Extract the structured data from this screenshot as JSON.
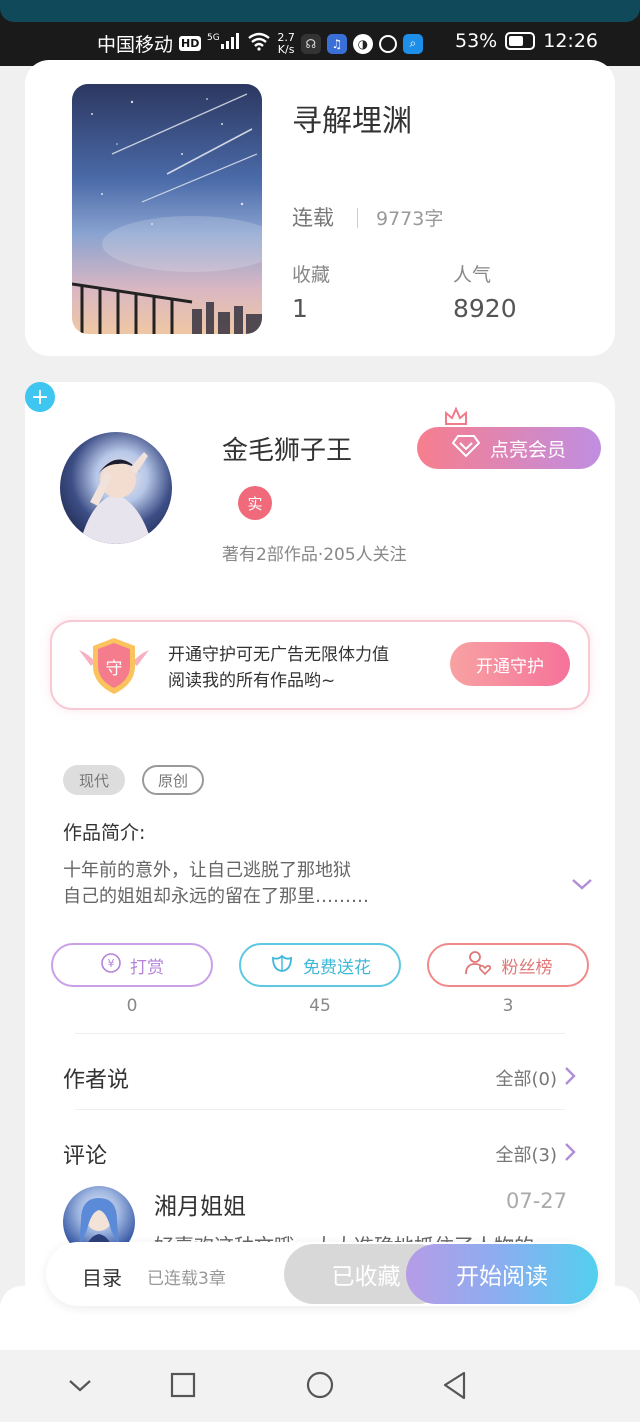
{
  "status_bar": {
    "carrier": "中国移动",
    "hd_badge": "HD",
    "signal_label": "5G",
    "net_speed_value": "2.7",
    "net_speed_unit": "K/s",
    "battery": "53%",
    "time": "12:26"
  },
  "book": {
    "title": "寻解埋渊",
    "status": "连载",
    "word_count": "9773字",
    "favorites_label": "收藏",
    "favorites_value": "1",
    "popularity_label": "人气",
    "popularity_value": "8920"
  },
  "author": {
    "name": "金毛狮子王",
    "verified_badge": "实",
    "stats": "著有2部作品·205人关注",
    "vip_button": "点亮会员"
  },
  "guard_banner": {
    "badge_text": "守",
    "line1": "开通守护可无广告无限体力值",
    "line2": "阅读我的所有作品哟~",
    "button": "开通守护"
  },
  "tags": {
    "items": [
      "现代",
      "原创"
    ],
    "add": "+"
  },
  "intro": {
    "title": "作品简介:",
    "line1": "十年前的意外，让自己逃脱了那地狱",
    "line2": "自己的姐姐却永远的留在了那里………"
  },
  "actions": {
    "reward": {
      "label": "打赏",
      "count": "0",
      "icon": "yen-icon"
    },
    "flower": {
      "label": "免费送花",
      "count": "45",
      "icon": "flower-icon"
    },
    "fans": {
      "label": "粉丝榜",
      "count": "3",
      "icon": "fan-heart-icon"
    }
  },
  "author_says": {
    "title": "作者说",
    "all": "全部(0)"
  },
  "comments": {
    "title": "评论",
    "all": "全部(3)",
    "items": [
      {
        "user": "湘月姐姐",
        "date": "07-27",
        "text": "好喜欢这种文哦，大大准确地抓住了人物的"
      }
    ]
  },
  "bottom_bar": {
    "toc": "目录",
    "chapters": "已连载3章",
    "collected": "已收藏",
    "read": "开始阅读"
  },
  "colors": {
    "accent_pink": "#f77e8d",
    "accent_purple": "#c08ee2",
    "accent_blue": "#52d0ee"
  }
}
